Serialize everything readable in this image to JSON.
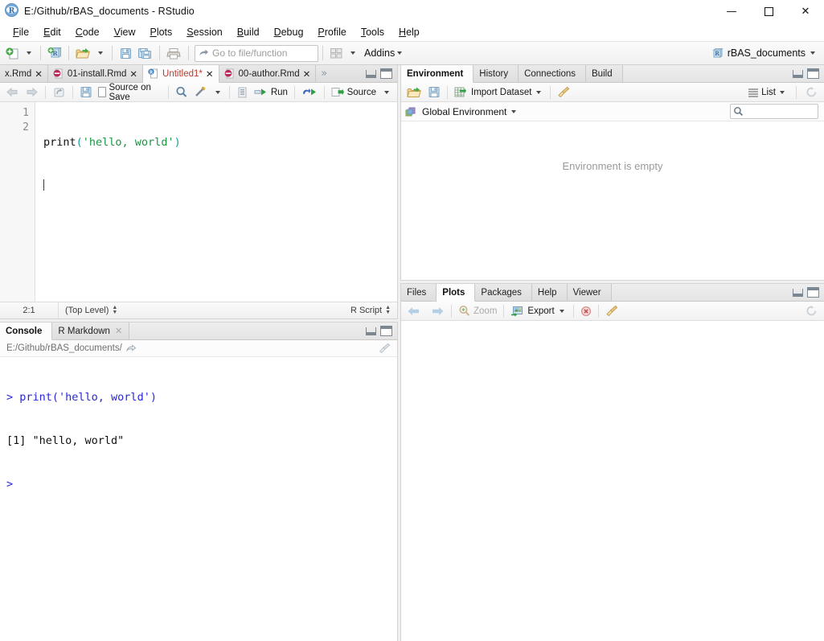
{
  "window": {
    "title": "E:/Github/rBAS_documents - RStudio",
    "app_icon": "r-logo-icon",
    "minimize": "—",
    "maximize": "☐",
    "close": "✕"
  },
  "menubar": {
    "items": [
      {
        "label": "File",
        "accel": "F"
      },
      {
        "label": "Edit",
        "accel": "E"
      },
      {
        "label": "Code",
        "accel": "C"
      },
      {
        "label": "View",
        "accel": "V"
      },
      {
        "label": "Plots",
        "accel": "P"
      },
      {
        "label": "Session",
        "accel": "S"
      },
      {
        "label": "Build",
        "accel": "B"
      },
      {
        "label": "Debug",
        "accel": "D"
      },
      {
        "label": "Profile",
        "accel": "P"
      },
      {
        "label": "Tools",
        "accel": "T"
      },
      {
        "label": "Help",
        "accel": "H"
      }
    ]
  },
  "main_toolbar": {
    "new_file_icon": "new-file-icon",
    "new_project_icon": "new-project-icon",
    "open_file_icon": "open-folder-icon",
    "save_icon": "save-icon",
    "save_all_icon": "save-all-icon",
    "print_icon": "print-icon",
    "goto_placeholder": "Go to file/function",
    "goto_value": "",
    "goto_icon": "goto-arrow-icon",
    "workspace_panes_icon": "panes-layout-icon",
    "addins_label": "Addins",
    "project_name": "rBAS_documents",
    "project_icon": "r-project-icon"
  },
  "source_pane": {
    "tabs": [
      {
        "label": "x.Rmd",
        "icon": "",
        "active": false,
        "modified": false,
        "closable": true
      },
      {
        "label": "01-install.Rmd",
        "icon": "rmd-icon",
        "active": false,
        "modified": false,
        "closable": true
      },
      {
        "label": "Untitled1*",
        "icon": "r-doc-icon",
        "active": true,
        "modified": true,
        "closable": true
      },
      {
        "label": "00-author.Rmd",
        "icon": "rmd-icon",
        "active": false,
        "modified": false,
        "closable": true
      }
    ],
    "overflow_icon": "chevron-double-right-icon",
    "toolbar": {
      "back_icon": "back-arrow-icon",
      "forward_icon": "forward-arrow-icon",
      "popout_icon": "show-in-new-window-icon",
      "save_icon": "save-icon",
      "source_on_save_label": "Source on Save",
      "source_on_save_checked": false,
      "find_icon": "search-icon",
      "magic_icon": "code-tools-icon",
      "compile_report_icon": "compile-report-icon",
      "run_label": "Run",
      "run_icon": "run-icon",
      "rerun_icon": "rerun-icon",
      "source_label": "Source",
      "source_icon": "source-icon"
    },
    "editor": {
      "line_numbers": [
        "1",
        "2"
      ],
      "lines": [
        {
          "tokens": [
            {
              "text": "print",
              "cls": "c-fn"
            },
            {
              "text": "(",
              "cls": "c-paren"
            },
            {
              "text": "'hello, world'",
              "cls": "c-str"
            },
            {
              "text": ")",
              "cls": "c-paren"
            }
          ]
        },
        {
          "tokens": [],
          "cursor": true
        }
      ]
    },
    "status": {
      "position": "2:1",
      "scope": "(Top Level)",
      "filetype": "R Script"
    }
  },
  "console_pane": {
    "tabs": [
      {
        "label": "Console",
        "active": true,
        "closable": false
      },
      {
        "label": "R Markdown",
        "active": false,
        "closable": true
      }
    ],
    "path": "E:/Github/rBAS_documents/",
    "path_icon": "show-directory-icon",
    "clear_icon": "broom-icon",
    "output": [
      {
        "type": "input",
        "prompt": "> ",
        "text": "print('hello, world')"
      },
      {
        "type": "output",
        "prompt": "",
        "text": "[1] \"hello, world\""
      },
      {
        "type": "prompt",
        "prompt": "> ",
        "text": ""
      }
    ]
  },
  "environment_pane": {
    "tabs": [
      {
        "label": "Environment",
        "active": true
      },
      {
        "label": "History",
        "active": false
      },
      {
        "label": "Connections",
        "active": false
      },
      {
        "label": "Build",
        "active": false
      }
    ],
    "toolbar": {
      "load_icon": "open-folder-icon",
      "save_icon": "save-icon",
      "import_label": "Import Dataset",
      "import_icon": "import-dataset-icon",
      "clear_icon": "broom-icon",
      "view_label": "List",
      "view_icon": "list-view-icon",
      "refresh_icon": "refresh-icon"
    },
    "scope": "Global Environment",
    "scope_icon": "environment-cube-icon",
    "search_value": "",
    "search_icon": "search-icon",
    "empty_message": "Environment is empty"
  },
  "files_pane": {
    "tabs": [
      {
        "label": "Files",
        "active": false
      },
      {
        "label": "Plots",
        "active": true
      },
      {
        "label": "Packages",
        "active": false
      },
      {
        "label": "Help",
        "active": false
      },
      {
        "label": "Viewer",
        "active": false
      }
    ],
    "toolbar": {
      "back_icon": "back-arrow-icon",
      "forward_icon": "forward-arrow-icon",
      "zoom_label": "Zoom",
      "zoom_icon": "zoom-icon",
      "zoom_disabled": true,
      "export_label": "Export",
      "export_icon": "export-image-icon",
      "remove_icon": "remove-plot-icon",
      "clear_icon": "broom-icon",
      "refresh_icon": "refresh-icon"
    }
  },
  "colors": {
    "accent_blue": "#2a27d6",
    "string_green": "#1a9641",
    "paren_teal": "#1c9e9e",
    "tab_active_red": "#c0392b",
    "muted_gray": "#9a9a9a"
  }
}
